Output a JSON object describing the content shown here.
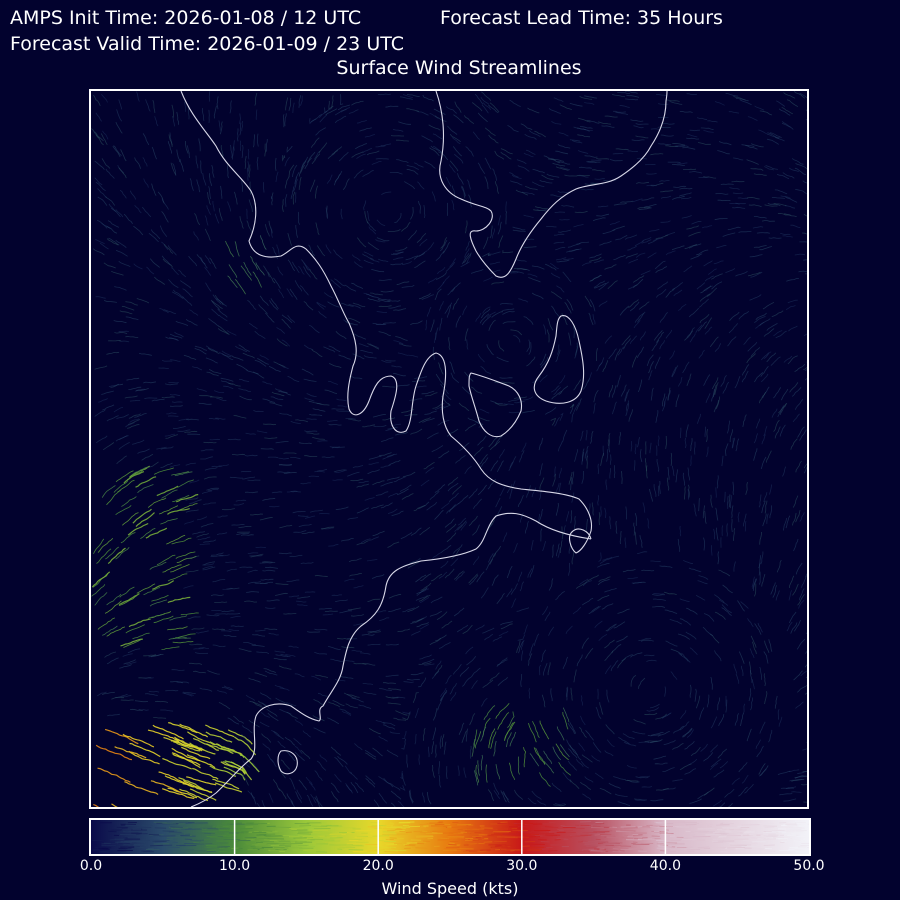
{
  "header": {
    "init_time": "AMPS Init Time: 2026-01-08 / 12 UTC",
    "lead_time": "Forecast Lead Time: 35 Hours",
    "valid_time": "Forecast Valid Time: 2026-01-09 / 23 UTC",
    "title": "Surface Wind Streamlines"
  },
  "colorbar": {
    "label": "Wind Speed (kts)",
    "range": [
      0,
      50
    ],
    "ticks": [
      "0.0",
      "10.0",
      "20.0",
      "30.0",
      "40.0",
      "50.0"
    ],
    "stops": [
      {
        "value": 0,
        "color": "#0a0a4a"
      },
      {
        "value": 5,
        "color": "#2a4a6a"
      },
      {
        "value": 10,
        "color": "#4a8a3a"
      },
      {
        "value": 15,
        "color": "#9ac83a"
      },
      {
        "value": 20,
        "color": "#e8d82a"
      },
      {
        "value": 25,
        "color": "#e87a10"
      },
      {
        "value": 30,
        "color": "#c81818"
      },
      {
        "value": 35,
        "color": "#b85060"
      },
      {
        "value": 40,
        "color": "#d8b8c8"
      },
      {
        "value": 50,
        "color": "#f2f2f8"
      }
    ]
  },
  "map": {
    "coastline_color": "#d8d8e8",
    "background_color": "#02022e"
  }
}
